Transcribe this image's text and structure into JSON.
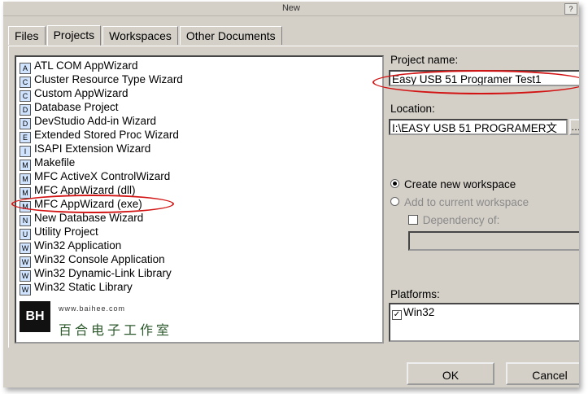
{
  "window": {
    "title": "New"
  },
  "tabs": [
    {
      "label": "Files"
    },
    {
      "label": "Projects"
    },
    {
      "label": "Workspaces"
    },
    {
      "label": "Other Documents"
    }
  ],
  "project_types": [
    "ATL COM AppWizard",
    "Cluster Resource Type Wizard",
    "Custom AppWizard",
    "Database Project",
    "DevStudio Add-in Wizard",
    "Extended Stored Proc Wizard",
    "ISAPI Extension Wizard",
    "Makefile",
    "MFC ActiveX ControlWizard",
    "MFC AppWizard (dll)",
    "MFC AppWizard (exe)",
    "New Database Wizard",
    "Utility Project",
    "Win32 Application",
    "Win32 Console Application",
    "Win32 Dynamic-Link Library",
    "Win32 Static Library"
  ],
  "selected_project_type": "MFC AppWizard (exe)",
  "watermark": {
    "logo": "BH",
    "url": "www.baihee.com",
    "brand": "百合电子工作室"
  },
  "form": {
    "project_name_label": "Project name:",
    "project_name_value": "Easy USB 51 Programer Test1",
    "location_label": "Location:",
    "location_value": "I:\\EASY USB 51 PROGRAMER文",
    "create_workspace_label": "Create new workspace",
    "add_workspace_label": "Add to current workspace",
    "dependency_label": "Dependency of:",
    "platforms_label": "Platforms:",
    "platforms": [
      "Win32"
    ]
  },
  "buttons": {
    "ok": "OK",
    "cancel": "Cancel"
  },
  "colors": {
    "highlight": "#d21414",
    "dialog_bg": "#d4d0c8"
  }
}
